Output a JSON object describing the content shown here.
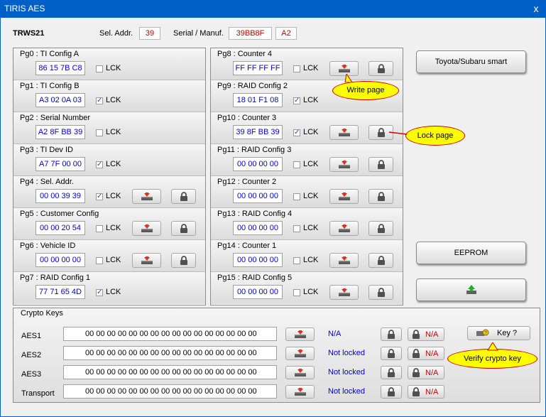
{
  "window": {
    "title": "TIRIS AES",
    "close": "x"
  },
  "header": {
    "device": "TRWS21",
    "sel_addr_label": "Sel. Addr.",
    "sel_addr_value": "39",
    "serial_label": "Serial / Manuf.",
    "serial_value": "39BB8F",
    "manuf_value": "A2"
  },
  "left_pages": [
    {
      "name": "Pg0 : TI Config A",
      "value": "86 15 7B C8",
      "checked": false,
      "lck": "LCK",
      "buttons": false
    },
    {
      "name": "Pg1 : TI Config B",
      "value": "A3 02 0A 03",
      "checked": true,
      "lck": "LCK",
      "buttons": false
    },
    {
      "name": "Pg2 : Serial Number",
      "value": "A2 8F BB 39",
      "checked": false,
      "lck": "LCK",
      "buttons": false
    },
    {
      "name": "Pg3 : TI Dev ID",
      "value": "A7 7F 00 00",
      "checked": true,
      "lck": "LCK",
      "buttons": false
    },
    {
      "name": "Pg4 : Sel. Addr.",
      "value": "00 00 39 39",
      "checked": true,
      "lck": "LCK",
      "buttons": true
    },
    {
      "name": "Pg5 : Customer Config",
      "value": "00 00 20 54",
      "checked": false,
      "lck": "LCK",
      "buttons": true
    },
    {
      "name": "Pg6 : Vehicle ID",
      "value": "00 00 00 00",
      "checked": false,
      "lck": "LCK",
      "buttons": true
    },
    {
      "name": "Pg7 : RAID Config 1",
      "value": "77 71 65 4D",
      "checked": true,
      "lck": "LCK",
      "buttons": false
    }
  ],
  "right_pages": [
    {
      "name": "Pg8 : Counter 4",
      "value": "FF FF FF FF",
      "checked": false,
      "lck": "LCK",
      "buttons": true
    },
    {
      "name": "Pg9 : RAID Config 2",
      "value": "18 01 F1 08",
      "checked": true,
      "lck": "LCK",
      "buttons": false
    },
    {
      "name": "Pg10 : Counter 3",
      "value": "39 8F BB 39",
      "checked": true,
      "lck": "LCK",
      "buttons": true
    },
    {
      "name": "Pg11 : RAID Config 3",
      "value": "00 00 00 00",
      "checked": false,
      "lck": "LCK",
      "buttons": true
    },
    {
      "name": "Pg12 : Counter 2",
      "value": "00 00 00 00",
      "checked": false,
      "lck": "LCK",
      "buttons": true
    },
    {
      "name": "Pg13 : RAID Config 4",
      "value": "00 00 00 00",
      "checked": false,
      "lck": "LCK",
      "buttons": true
    },
    {
      "name": "Pg14 : Counter 1",
      "value": "00 00 00 00",
      "checked": false,
      "lck": "LCK",
      "buttons": true
    },
    {
      "name": "Pg15 : RAID Config 5",
      "value": "00 00 00 00",
      "checked": false,
      "lck": "LCK",
      "buttons": true
    }
  ],
  "side_buttons": {
    "toyota": "Toyota/Subaru smart",
    "eeprom": "EEPROM"
  },
  "callouts": {
    "write": "Write page",
    "lock": "Lock page",
    "verify": "Verify crypto key"
  },
  "crypto": {
    "title": "Crypto Keys",
    "key_button": "Key ?",
    "na": "N/A",
    "rows": [
      {
        "name": "AES1",
        "value": "00 00 00 00 00 00 00 00 00 00 00 00 00 00 00 00",
        "status": "N/A"
      },
      {
        "name": "AES2",
        "value": "00 00 00 00 00 00 00 00 00 00 00 00 00 00 00 00",
        "status": "Not locked"
      },
      {
        "name": "AES3",
        "value": "00 00 00 00 00 00 00 00 00 00 00 00 00 00 00 00",
        "status": "Not locked"
      },
      {
        "name": "Transport",
        "value": "00 00 00 00 00 00 00 00 00 00 00 00 00 00 00 00",
        "status": "Not locked"
      }
    ]
  },
  "icons": {
    "write": "chip-write-icon",
    "lock": "padlock-icon",
    "key": "key-icon",
    "upload": "upload-arrow-icon"
  }
}
